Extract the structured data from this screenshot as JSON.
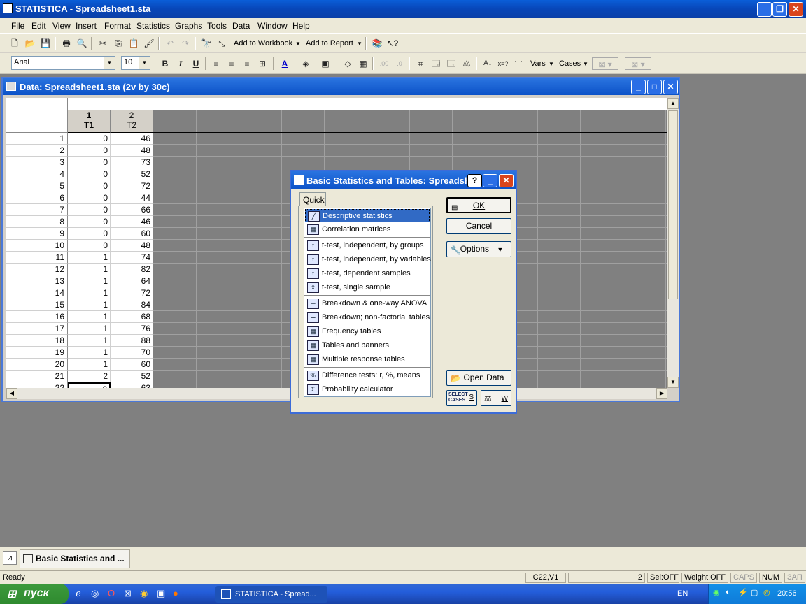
{
  "app": {
    "title": "STATISTICA - Spreadsheet1.sta",
    "window_controls": [
      "_",
      "❐",
      "✕"
    ]
  },
  "menu": [
    "File",
    "Edit",
    "View",
    "Insert",
    "Format",
    "Statistics",
    "Graphs",
    "Tools",
    "Data",
    "Window",
    "Help"
  ],
  "toolbar1": {
    "add_to_workbook": "Add to Workbook",
    "add_to_report": "Add to Report"
  },
  "toolbar2": {
    "font": "Arial",
    "size": "10",
    "bold": "B",
    "italic": "I",
    "underline": "U",
    "vars": "Vars",
    "cases": "Cases"
  },
  "datawin": {
    "title": "Data: Spreadsheet1.sta (2v by 30c)",
    "columns": [
      {
        "num": "1",
        "name": "T1"
      },
      {
        "num": "2",
        "name": "T2"
      }
    ],
    "rows": [
      {
        "n": "1",
        "t1": "0",
        "t2": "46"
      },
      {
        "n": "2",
        "t1": "0",
        "t2": "48"
      },
      {
        "n": "3",
        "t1": "0",
        "t2": "73"
      },
      {
        "n": "4",
        "t1": "0",
        "t2": "52"
      },
      {
        "n": "5",
        "t1": "0",
        "t2": "72"
      },
      {
        "n": "6",
        "t1": "0",
        "t2": "44"
      },
      {
        "n": "7",
        "t1": "0",
        "t2": "66"
      },
      {
        "n": "8",
        "t1": "0",
        "t2": "46"
      },
      {
        "n": "9",
        "t1": "0",
        "t2": "60"
      },
      {
        "n": "10",
        "t1": "0",
        "t2": "48"
      },
      {
        "n": "11",
        "t1": "1",
        "t2": "74"
      },
      {
        "n": "12",
        "t1": "1",
        "t2": "82"
      },
      {
        "n": "13",
        "t1": "1",
        "t2": "64"
      },
      {
        "n": "14",
        "t1": "1",
        "t2": "72"
      },
      {
        "n": "15",
        "t1": "1",
        "t2": "84"
      },
      {
        "n": "16",
        "t1": "1",
        "t2": "68"
      },
      {
        "n": "17",
        "t1": "1",
        "t2": "76"
      },
      {
        "n": "18",
        "t1": "1",
        "t2": "88"
      },
      {
        "n": "19",
        "t1": "1",
        "t2": "70"
      },
      {
        "n": "20",
        "t1": "1",
        "t2": "60"
      },
      {
        "n": "21",
        "t1": "2",
        "t2": "52"
      },
      {
        "n": "22",
        "t1": "2",
        "t2": "63"
      }
    ]
  },
  "dialog": {
    "title": "Basic Statistics and Tables: Spreadsh",
    "tab": "Quick",
    "items": [
      "Descriptive statistics",
      "Correlation matrices",
      "t-test, independent, by groups",
      "t-test, independent, by variables",
      "t-test, dependent samples",
      "t-test, single sample",
      "Breakdown & one-way ANOVA",
      "Breakdown; non-factorial tables",
      "Frequency tables",
      "Tables and banners",
      "Multiple response tables",
      "Difference tests: r, %, means",
      "Probability calculator"
    ],
    "ok": "OK",
    "cancel": "Cancel",
    "options": "Options",
    "open_data": "Open Data",
    "select_cases": "SELECT CASES",
    "s": "S",
    "w": "W"
  },
  "mdi_task": "Basic Statistics and ...",
  "status": {
    "ready": "Ready",
    "cell": "C22,V1",
    "num": "2",
    "sel": "Sel:OFF",
    "weight": "Weight:OFF",
    "caps": "CAPS",
    "numlock": "NUM",
    "zap": "ЗАП"
  },
  "taskbar": {
    "start": "пуск",
    "task": "STATISTICA - Spread...",
    "lang": "EN",
    "time": "20:56"
  }
}
